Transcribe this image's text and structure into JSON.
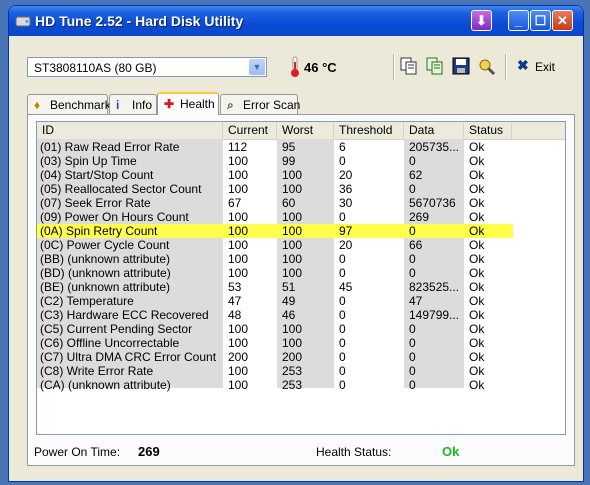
{
  "window": {
    "title": "HD Tune 2.52 - Hard Disk Utility"
  },
  "toolbar": {
    "drive": "ST3808110AS (80 GB)",
    "temperature": "46 °C",
    "exit_label": "Exit"
  },
  "tabs": [
    {
      "label": "Benchmark",
      "icon": "benchmark-icon"
    },
    {
      "label": "Info",
      "icon": "info-icon"
    },
    {
      "label": "Health",
      "icon": "health-cross-icon"
    },
    {
      "label": "Error Scan",
      "icon": "error-scan-icon"
    }
  ],
  "active_tab": "Health",
  "columns": [
    "ID",
    "Current",
    "Worst",
    "Threshold",
    "Data",
    "Status"
  ],
  "rows": [
    {
      "id": "(01) Raw Read Error Rate",
      "current": "112",
      "worst": "95",
      "threshold": "6",
      "data": "205735...",
      "status": "Ok"
    },
    {
      "id": "(03) Spin Up Time",
      "current": "100",
      "worst": "99",
      "threshold": "0",
      "data": "0",
      "status": "Ok"
    },
    {
      "id": "(04) Start/Stop Count",
      "current": "100",
      "worst": "100",
      "threshold": "20",
      "data": "62",
      "status": "Ok"
    },
    {
      "id": "(05) Reallocated Sector Count",
      "current": "100",
      "worst": "100",
      "threshold": "36",
      "data": "0",
      "status": "Ok"
    },
    {
      "id": "(07) Seek Error Rate",
      "current": "67",
      "worst": "60",
      "threshold": "30",
      "data": "5670736",
      "status": "Ok"
    },
    {
      "id": "(09) Power On Hours Count",
      "current": "100",
      "worst": "100",
      "threshold": "0",
      "data": "269",
      "status": "Ok"
    },
    {
      "id": "(0A) Spin Retry Count",
      "current": "100",
      "worst": "100",
      "threshold": "97",
      "data": "0",
      "status": "Ok"
    },
    {
      "id": "(0C) Power Cycle Count",
      "current": "100",
      "worst": "100",
      "threshold": "20",
      "data": "66",
      "status": "Ok"
    },
    {
      "id": "(BB) (unknown attribute)",
      "current": "100",
      "worst": "100",
      "threshold": "0",
      "data": "0",
      "status": "Ok"
    },
    {
      "id": "(BD) (unknown attribute)",
      "current": "100",
      "worst": "100",
      "threshold": "0",
      "data": "0",
      "status": "Ok"
    },
    {
      "id": "(BE) (unknown attribute)",
      "current": "53",
      "worst": "51",
      "threshold": "45",
      "data": "823525...",
      "status": "Ok"
    },
    {
      "id": "(C2) Temperature",
      "current": "47",
      "worst": "49",
      "threshold": "0",
      "data": "47",
      "status": "Ok"
    },
    {
      "id": "(C3) Hardware ECC Recovered",
      "current": "48",
      "worst": "46",
      "threshold": "0",
      "data": "149799...",
      "status": "Ok"
    },
    {
      "id": "(C5) Current Pending Sector",
      "current": "100",
      "worst": "100",
      "threshold": "0",
      "data": "0",
      "status": "Ok"
    },
    {
      "id": "(C6) Offline Uncorrectable",
      "current": "100",
      "worst": "100",
      "threshold": "0",
      "data": "0",
      "status": "Ok"
    },
    {
      "id": "(C7) Ultra DMA CRC Error Count",
      "current": "200",
      "worst": "200",
      "threshold": "0",
      "data": "0",
      "status": "Ok"
    },
    {
      "id": "(C8) Write Error Rate",
      "current": "100",
      "worst": "253",
      "threshold": "0",
      "data": "0",
      "status": "Ok"
    },
    {
      "id": "(CA) (unknown attribute)",
      "current": "100",
      "worst": "253",
      "threshold": "0",
      "data": "0",
      "status": "Ok"
    }
  ],
  "highlighted_row": "(0A) Spin Retry Count",
  "footer": {
    "power_on_label": "Power On Time:",
    "power_on_value": "269",
    "health_label": "Health Status:",
    "health_value": "Ok"
  },
  "colors": {
    "highlight": "#ffff4c",
    "ok_green": "#1db61d",
    "titlebar_blue": "#0a4bd3"
  }
}
